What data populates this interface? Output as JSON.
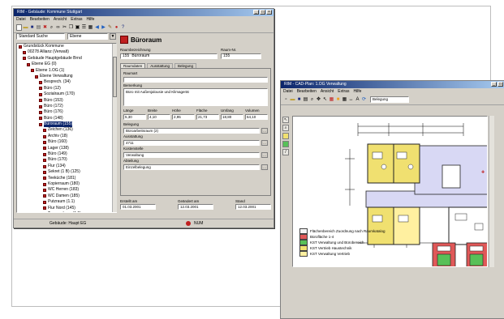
{
  "win1": {
    "title": "RIM - Gebäude: Kommune Stuttgart",
    "menu": [
      "Datei",
      "Bearbeiten",
      "Ansicht",
      "Extras",
      "Hilfe"
    ],
    "filter": {
      "mode": "Standard Suche",
      "scope": "Ebene"
    },
    "tree": [
      {
        "label": "Grundstück Kommune",
        "level": 0
      },
      {
        "label": "00278 Allianz (Verwalt)",
        "level": 1
      },
      {
        "label": "Gebäude Hauptgebäude Brnd",
        "level": 1
      },
      {
        "label": "Ebene EG (0)",
        "level": 2
      },
      {
        "label": "Ebene 1.OG (1)",
        "level": 3
      },
      {
        "label": "Ebene Verwaltung",
        "level": 4
      },
      {
        "label": "Besprech. (34)",
        "level": 5
      },
      {
        "label": "Büro (12)",
        "level": 5
      },
      {
        "label": "Sozialraum (170)",
        "level": 5
      },
      {
        "label": "Büro (153)",
        "level": 5
      },
      {
        "label": "Büro (172)",
        "level": 5
      },
      {
        "label": "Büro (176)",
        "level": 5
      },
      {
        "label": "Büro (148)",
        "level": 5
      },
      {
        "label": "Büroraum (155)",
        "level": 5,
        "selected": true
      },
      {
        "label": "Zeichen (136)",
        "level": 6
      },
      {
        "label": "Archiv (18)",
        "level": 6
      },
      {
        "label": "Büro (160)",
        "level": 6
      },
      {
        "label": "Lager (138)",
        "level": 6
      },
      {
        "label": "Büro (149)",
        "level": 6
      },
      {
        "label": "Büro (170)",
        "level": 6
      },
      {
        "label": "Flur (134)",
        "level": 6
      },
      {
        "label": "Sekret (1 B) (125)",
        "level": 6
      },
      {
        "label": "Teeküche (181)",
        "level": 6
      },
      {
        "label": "Kopierraum (180)",
        "level": 6
      },
      {
        "label": "WC Herren (183)",
        "level": 6
      },
      {
        "label": "WC Damen (185)",
        "level": 6
      },
      {
        "label": "Putzraum (1.1)",
        "level": 6
      },
      {
        "label": "Flur Nord (145)",
        "level": 6
      },
      {
        "label": "Treppenhaus (1.5)",
        "level": 6
      },
      {
        "label": "Zugang (27)",
        "level": 6
      }
    ],
    "panel": {
      "heading": "Büroraum",
      "name_label": "Raumbezeichnung",
      "nr_label": "Raum-Nr.",
      "name_value": "Büroraum",
      "nr_value": "155",
      "tabs": [
        "Raumdaten",
        "Ausstattung",
        "Belegung"
      ],
      "sections": [
        "Raumart",
        "Bemerkung",
        "Belegung",
        "Ausstattung",
        "Kostenstelle",
        "Abteilung"
      ],
      "memo": "Büro mit Außenjalousie und Klimagerät",
      "grid_labels": [
        "Länge",
        "Breite",
        "Höhe",
        "Fläche",
        "Umfang",
        "Volumen"
      ],
      "grid_values": [
        "5,30",
        "4,10",
        "2,95",
        "21,73",
        "18,80",
        "64,10"
      ],
      "combo_values": [
        "Büroarbeitsraum (2)",
        "4711",
        "Verwaltung",
        "Einzelbelegung"
      ],
      "footer": [
        {
          "label": "Erstellt am",
          "value": "01.03.2001"
        },
        {
          "label": "Geändert am",
          "value": "12.03.2001"
        },
        {
          "label": "Stand",
          "value": "12.03.2001"
        }
      ]
    },
    "status": [
      "Gebäude: Haupt EG",
      "NUM"
    ]
  },
  "win2": {
    "title": "RIM - CAD-Plan: 1.OG Verwaltung",
    "menu": [
      "Datei",
      "Bearbeiten",
      "Ansicht",
      "Extras",
      "Hilfe"
    ],
    "layer": "Belegung",
    "legend": [
      {
        "color": "#f4f4f4",
        "text": "Flächenbereich Zuordnung nach Raumkatalog"
      },
      {
        "color": "#e05858",
        "text": "Bürofläche 1-4"
      },
      {
        "color": "#58c058",
        "text": "KST Verwaltung und Bürobereich"
      },
      {
        "color": "#f0e070",
        "text": "KST Vertrieb Haustechnik"
      },
      {
        "color": "#fff0a0",
        "text": "KST Verwaltung Vertrieb"
      }
    ]
  },
  "colors": {
    "highlight": "#f0e070",
    "corridor": "#d8d8f4",
    "green": "#58c058",
    "red": "#e05858"
  }
}
